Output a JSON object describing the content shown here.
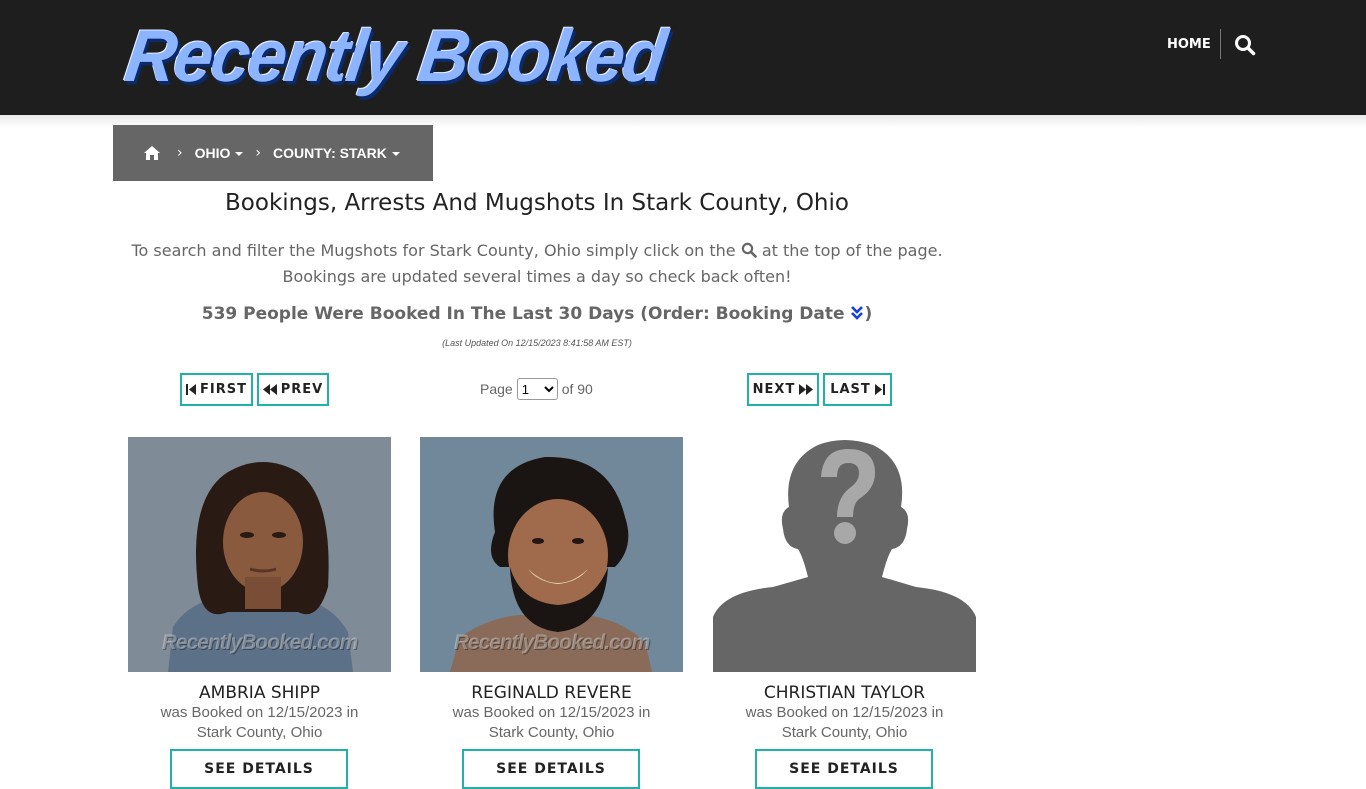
{
  "header": {
    "logo_text": "Recently Booked",
    "nav_home": "HOME"
  },
  "breadcrumb": {
    "state": "OHIO",
    "county": "COUNTY: STARK"
  },
  "main": {
    "title": "Bookings, Arrests And Mugshots In Stark County, Ohio",
    "intro_before": "To search and filter the Mugshots for Stark County, Ohio simply click on the",
    "intro_after": "at the top of the page. Bookings are updated several times a day so check back often!",
    "count_text": "539 People Were Booked In The Last 30 Days (Order: Booking Date",
    "count_close": ")",
    "last_updated": "(Last Updated On 12/15/2023 8:41:58 AM EST)"
  },
  "pagination": {
    "first": "FIRST",
    "prev": "PREV",
    "page_label": "Page",
    "current_page": "1",
    "of_label": "of 90",
    "next": "NEXT",
    "last": "LAST"
  },
  "watermark": "RecentlyBooked.com",
  "bookings": [
    {
      "name": "AMBRIA SHIPP",
      "info": "was Booked on 12/15/2023 in Stark County, Ohio",
      "button": "SEE DETAILS"
    },
    {
      "name": "REGINALD REVERE",
      "info": "was Booked on 12/15/2023 in Stark County, Ohio",
      "button": "SEE DETAILS"
    },
    {
      "name": "CHRISTIAN TAYLOR",
      "info": "was Booked on 12/15/2023 in Stark County, Ohio",
      "button": "SEE DETAILS"
    }
  ],
  "colors": {
    "header_bg": "#1e1e1e",
    "breadcrumb_bg": "#666666",
    "accent": "#20b2aa"
  }
}
